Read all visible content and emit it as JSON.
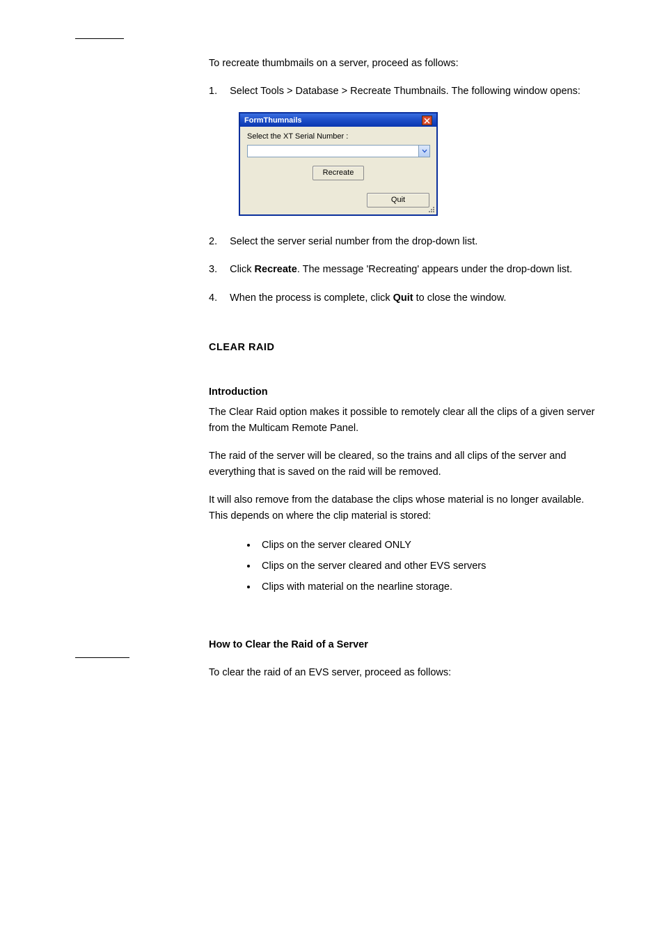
{
  "body": {
    "p1": "To recreate thumbmails on a server, proceed as follows:",
    "step1_label": "1.",
    "step1_text": "Select Tools > Database > Recreate Thumbnails. The following window opens:",
    "step2_label": "2.",
    "step2_text": "Select the server serial number from the drop-down list.",
    "step3_label": "3.",
    "step3_text_a": "Click ",
    "step3_text_b": "Recreate",
    "step3_text_c": ". The message 'Recreating' appears under the drop-down list.",
    "step4_label": "4.",
    "step4_text_a": "When the process is complete, click ",
    "step4_text_b": "Quit",
    "step4_text_c": " to close the window.",
    "h_clear": "CLEAR RAID",
    "h_intro": "Introduction",
    "p5": "The Clear Raid option makes it possible to remotely clear all the clips of a given server from the Multicam Remote Panel.",
    "p6": "The raid of the server will be cleared, so the trains and all clips of the server and everything that is saved on the raid will be removed.",
    "p7": "It will also remove from the database the clips whose material is no longer available. This depends on where the clip material is stored:",
    "li1": "Clips on the server cleared ONLY",
    "li2": "Clips on the server cleared and other EVS servers",
    "li3": "Clips with material on the nearline storage.",
    "h_howto": "How to Clear the Raid of a Server",
    "p8": "To clear the raid of an EVS server, proceed as follows:"
  },
  "dialog": {
    "title": "FormThumnails",
    "label": "Select the XT Serial Number :",
    "value": "",
    "recreate": "Recreate",
    "quit": "Quit"
  }
}
